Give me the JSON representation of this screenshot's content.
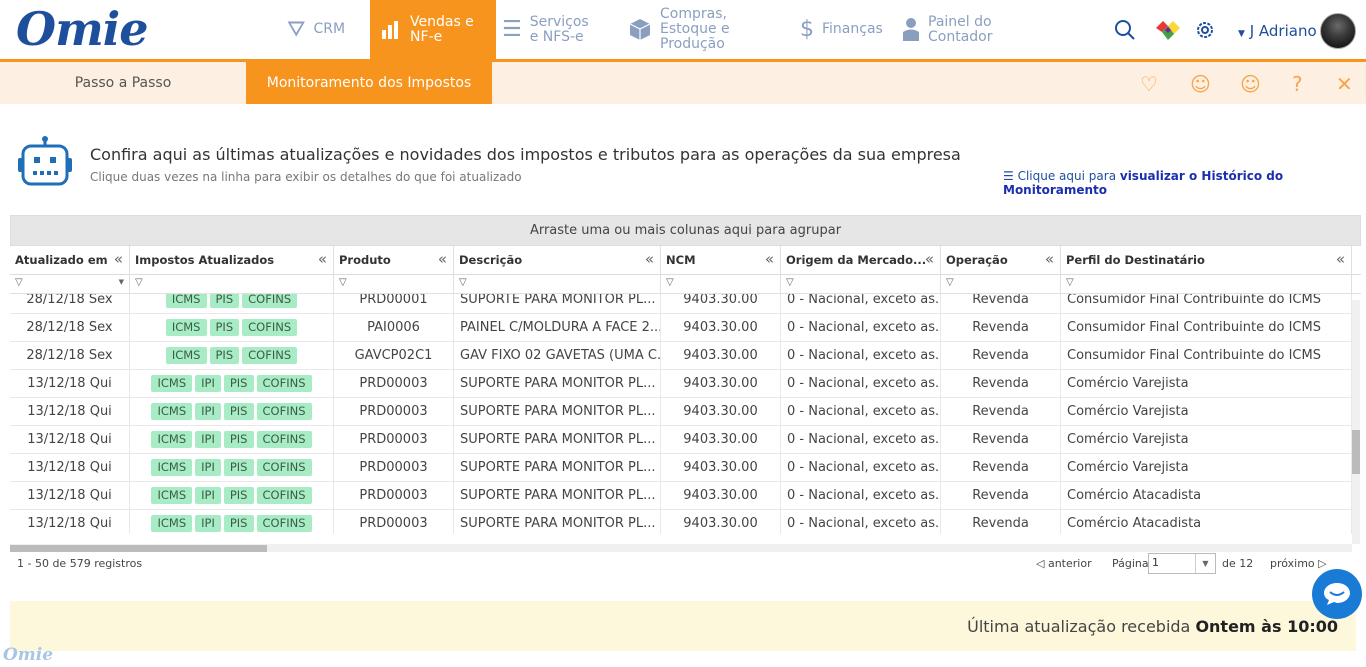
{
  "app": {
    "logo": "Omie"
  },
  "nav": [
    {
      "label": "CRM",
      "icon": "funnel-icon"
    },
    {
      "label": "Vendas e NF-e",
      "icon": "bar-chart-icon"
    },
    {
      "label": "Serviços e NFS-e",
      "icon": "list-icon"
    },
    {
      "label": "Compras, Estoque e Produção",
      "icon": "box-icon"
    },
    {
      "label": "Finanças",
      "icon": "dollar-icon"
    },
    {
      "label": "Painel do Contador",
      "icon": "person-icon"
    }
  ],
  "user": {
    "name": "J Adriano"
  },
  "subtabs": [
    "Passo a Passo",
    "Monitoramento dos Impostos"
  ],
  "intro": {
    "headline": "Confira aqui as últimas atualizações e novidades dos impostos e tributos para as operações da sua empresa",
    "subline": "Clique duas vezes na linha para exibir os detalhes do que foi atualizado",
    "link_prefix": "Clique aqui para",
    "link_bold": "visualizar o Histórico do Monitoramento"
  },
  "grid": {
    "group_hint": "Arraste uma ou mais colunas aqui para agrupar",
    "columns": [
      "Atualizado em",
      "Impostos Atualizados",
      "Produto",
      "Descrição",
      "NCM",
      "Origem da Mercado...",
      "Operação",
      "Perfil do Destinatário"
    ],
    "rows": [
      {
        "date": "28/12/18 Sex",
        "taxes": [
          "ICMS",
          "PIS",
          "COFINS"
        ],
        "produto": "PRD00001",
        "descricao": "SUPORTE PARA MONITOR PL...",
        "ncm": "9403.30.00",
        "origem": "0 - Nacional, exceto as...",
        "operacao": "Revenda",
        "perfil": "Consumidor Final Contribuinte do ICMS"
      },
      {
        "date": "28/12/18 Sex",
        "taxes": [
          "ICMS",
          "PIS",
          "COFINS"
        ],
        "produto": "PAI0006",
        "descricao": "PAINEL C/MOLDURA A FACE 2...",
        "ncm": "9403.30.00",
        "origem": "0 - Nacional, exceto as...",
        "operacao": "Revenda",
        "perfil": "Consumidor Final Contribuinte do ICMS"
      },
      {
        "date": "28/12/18 Sex",
        "taxes": [
          "ICMS",
          "PIS",
          "COFINS"
        ],
        "produto": "GAVCP02C1",
        "descricao": "GAV FIXO 02 GAVETAS (UMA C...",
        "ncm": "9403.30.00",
        "origem": "0 - Nacional, exceto as...",
        "operacao": "Revenda",
        "perfil": "Consumidor Final Contribuinte do ICMS"
      },
      {
        "date": "13/12/18 Qui",
        "taxes": [
          "ICMS",
          "IPI",
          "PIS",
          "COFINS"
        ],
        "produto": "PRD00003",
        "descricao": "SUPORTE PARA MONITOR PL...",
        "ncm": "9403.30.00",
        "origem": "0 - Nacional, exceto as...",
        "operacao": "Revenda",
        "perfil": "Comércio Varejista"
      },
      {
        "date": "13/12/18 Qui",
        "taxes": [
          "ICMS",
          "IPI",
          "PIS",
          "COFINS"
        ],
        "produto": "PRD00003",
        "descricao": "SUPORTE PARA MONITOR PL...",
        "ncm": "9403.30.00",
        "origem": "0 - Nacional, exceto as...",
        "operacao": "Revenda",
        "perfil": "Comércio Varejista"
      },
      {
        "date": "13/12/18 Qui",
        "taxes": [
          "ICMS",
          "IPI",
          "PIS",
          "COFINS"
        ],
        "produto": "PRD00003",
        "descricao": "SUPORTE PARA MONITOR PL...",
        "ncm": "9403.30.00",
        "origem": "0 - Nacional, exceto as...",
        "operacao": "Revenda",
        "perfil": "Comércio Varejista"
      },
      {
        "date": "13/12/18 Qui",
        "taxes": [
          "ICMS",
          "IPI",
          "PIS",
          "COFINS"
        ],
        "produto": "PRD00003",
        "descricao": "SUPORTE PARA MONITOR PL...",
        "ncm": "9403.30.00",
        "origem": "0 - Nacional, exceto as...",
        "operacao": "Revenda",
        "perfil": "Comércio Varejista"
      },
      {
        "date": "13/12/18 Qui",
        "taxes": [
          "ICMS",
          "IPI",
          "PIS",
          "COFINS"
        ],
        "produto": "PRD00003",
        "descricao": "SUPORTE PARA MONITOR PL...",
        "ncm": "9403.30.00",
        "origem": "0 - Nacional, exceto as...",
        "operacao": "Revenda",
        "perfil": "Comércio Atacadista"
      },
      {
        "date": "13/12/18 Qui",
        "taxes": [
          "ICMS",
          "IPI",
          "PIS",
          "COFINS"
        ],
        "produto": "PRD00003",
        "descricao": "SUPORTE PARA MONITOR PL...",
        "ncm": "9403.30.00",
        "origem": "0 - Nacional, exceto as...",
        "operacao": "Revenda",
        "perfil": "Comércio Atacadista"
      }
    ]
  },
  "pager": {
    "records": "1 - 50 de 579 registros",
    "prev": "anterior",
    "page_label": "Página",
    "page": "1",
    "of": "de 12",
    "next": "próximo"
  },
  "footer": {
    "prefix": "Última atualização recebida",
    "bold": "Ontem às 10:00"
  },
  "colors": {
    "accent": "#f7941d",
    "brand": "#1e4f9c",
    "badge": "#a7ecc5"
  }
}
